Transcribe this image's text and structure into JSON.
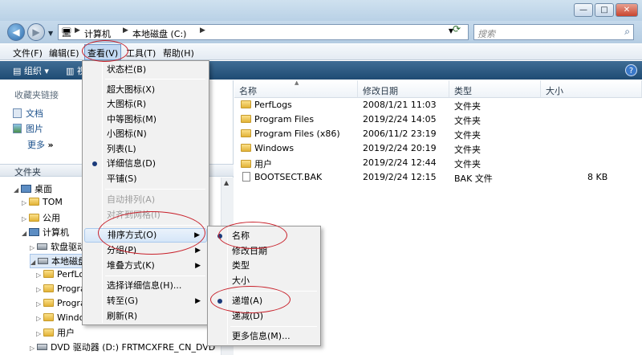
{
  "window": {
    "controls": {
      "minimize": "—",
      "maximize": "□",
      "close": "✕"
    }
  },
  "address": {
    "crumbs": [
      "计算机",
      "本地磁盘 (C:)"
    ],
    "search_placeholder": "搜索"
  },
  "menubar": {
    "items": [
      "文件(F)",
      "编辑(E)",
      "查看(V)",
      "工具(T)",
      "帮助(H)"
    ]
  },
  "toolbar": {
    "organize": "组织",
    "views": "视"
  },
  "navpane": {
    "favorites_header": "收藏夹链接",
    "favorites": [
      "文档",
      "图片"
    ],
    "more": "更多",
    "folders_header": "文件夹",
    "tree": [
      {
        "label": "桌面",
        "icon": "desktop-icon"
      },
      {
        "label": "TOM",
        "icon": "folder-icon"
      },
      {
        "label": "公用",
        "icon": "folder-icon"
      },
      {
        "label": "计算机",
        "icon": "computer-icon"
      },
      {
        "label": "软盘驱动",
        "icon": "floppy-icon"
      },
      {
        "label": "本地磁盘",
        "icon": "drive-icon"
      },
      {
        "label": "PerfLogs",
        "icon": "folder-icon"
      },
      {
        "label": "Progra",
        "icon": "folder-icon"
      },
      {
        "label": "Progra",
        "icon": "folder-icon"
      },
      {
        "label": "Windo",
        "icon": "folder-icon"
      },
      {
        "label": "用户",
        "icon": "folder-icon"
      },
      {
        "label": "DVD 驱动器 (D:) FRTMCXFRE_CN_DVD",
        "icon": "dvd-icon"
      }
    ]
  },
  "content": {
    "columns": [
      "名称",
      "修改日期",
      "类型",
      "大小"
    ],
    "files": [
      {
        "name": "PerfLogs",
        "date": "2008/1/21 11:03",
        "type": "文件夹",
        "size": "",
        "icon": "folder-icon"
      },
      {
        "name": "Program Files",
        "date": "2019/2/24 14:05",
        "type": "文件夹",
        "size": "",
        "icon": "folder-icon"
      },
      {
        "name": "Program Files (x86)",
        "date": "2006/11/2 23:19",
        "type": "文件夹",
        "size": "",
        "icon": "folder-icon"
      },
      {
        "name": "Windows",
        "date": "2019/2/24 20:19",
        "type": "文件夹",
        "size": "",
        "icon": "folder-icon"
      },
      {
        "name": "用户",
        "date": "2019/2/24 12:44",
        "type": "文件夹",
        "size": "",
        "icon": "folder-icon"
      },
      {
        "name": "BOOTSECT.BAK",
        "date": "2019/2/24 12:15",
        "type": "BAK 文件",
        "size": "8 KB",
        "icon": "file-icon"
      }
    ]
  },
  "view_menu": {
    "items": [
      {
        "label": "状态栏(B)"
      },
      {
        "label": "超大图标(X)"
      },
      {
        "label": "大图标(R)"
      },
      {
        "label": "中等图标(M)"
      },
      {
        "label": "小图标(N)"
      },
      {
        "label": "列表(L)"
      },
      {
        "label": "详细信息(D)",
        "checked": true
      },
      {
        "label": "平铺(S)"
      },
      {
        "label": "自动排列(A)",
        "disabled": true
      },
      {
        "label": "对齐到网格(I)",
        "disabled": true
      },
      {
        "label": "排序方式(O)",
        "submenu": true,
        "highlighted": true
      },
      {
        "label": "分组(P)",
        "submenu": true
      },
      {
        "label": "堆叠方式(K)",
        "submenu": true
      },
      {
        "label": "选择详细信息(H)..."
      },
      {
        "label": "转至(G)",
        "submenu": true
      },
      {
        "label": "刷新(R)"
      }
    ]
  },
  "sort_menu": {
    "items": [
      {
        "label": "名称",
        "checked": true
      },
      {
        "label": "修改日期"
      },
      {
        "label": "类型"
      },
      {
        "label": "大小"
      },
      {
        "label": "递增(A)",
        "checked": true
      },
      {
        "label": "递减(D)"
      },
      {
        "label": "更多信息(M)..."
      }
    ]
  },
  "colors": {
    "annotation": "#c8202a",
    "toolbar": "#2a5882",
    "menu_highlight": "#c2d8f2"
  }
}
